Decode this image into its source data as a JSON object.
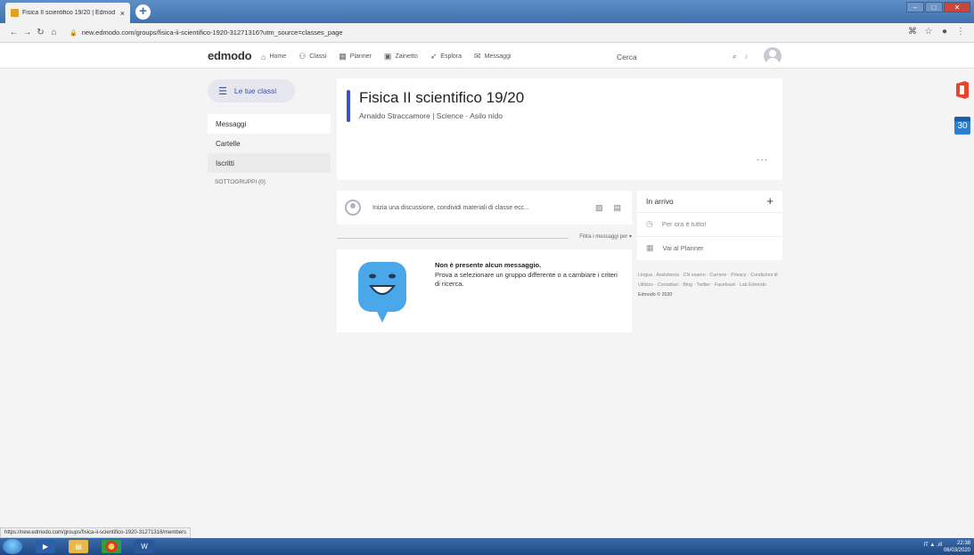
{
  "browser": {
    "tab_title": "Fisica II scientifico 19/20 | Edmod",
    "tab_close": "×",
    "new_tab": "+",
    "url": "new.edmodo.com/groups/fisica-ii-scientifico-1920-31271316?utm_source=classes_page",
    "status_url": "https://new.edmodo.com/groups/fisica-ii-scientifico-1920-31271316/members"
  },
  "nav": {
    "logo": "edmodo",
    "items": [
      {
        "label": "Home",
        "icon": "⌂"
      },
      {
        "label": "Classi",
        "icon": "⚇"
      },
      {
        "label": "Planner",
        "icon": "▦"
      },
      {
        "label": "Zainetto",
        "icon": "▣"
      },
      {
        "label": "Esplora",
        "icon": "➶"
      },
      {
        "label": "Messaggi",
        "icon": "✉"
      }
    ],
    "search_placeholder": "Cerca"
  },
  "sidebar": {
    "classes_button": "Le tue classi",
    "links": [
      "Messaggi",
      "Cartelle",
      "Iscritti"
    ],
    "subgroups": "SOTTOGRUPPI (0)"
  },
  "group": {
    "name": "Fisica II scientifico 19/20",
    "subtitle": "Arnaldo Straccamore | Science · Asilo nido",
    "more": "···"
  },
  "post": {
    "placeholder": "Inizia una discussione, condividi materiali di classe ecc..."
  },
  "filter": {
    "label": "Filtra i messaggi per ▾"
  },
  "empty": {
    "title": "Non è presente alcun messaggio.",
    "text": "Prova a selezionare un gruppo differente o a cambiare i criteri di ricerca."
  },
  "inbox": {
    "title": "In arrivo",
    "plus": "+",
    "row1": "Per ora è tutto!",
    "row2": "Vai al Planner"
  },
  "footer": {
    "links": "Lingua · Assistenza · CN esamo · Carriere · Privacy · Condizioni di Utilizzo · Contattaci · Blog · Twitter · Facebook · Lab Edmodo",
    "copyright": "Edmodo © 2020"
  },
  "side_icons": {
    "calendar_day": "30"
  },
  "taskbar": {
    "tray": "IT  ▲  .ıll",
    "time": "22:38",
    "date": "06/03/2020"
  },
  "colors": {
    "accent": "#3b52c5",
    "mascot": "#4aa8e8",
    "office": "#e8452c"
  }
}
